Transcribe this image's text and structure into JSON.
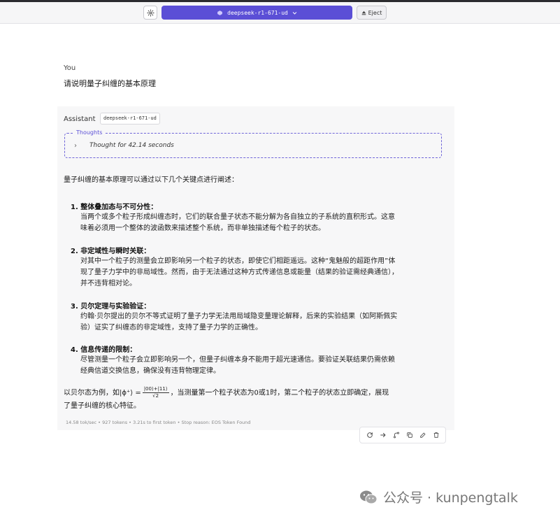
{
  "header": {
    "model_name": "deepseek-r1-671-ud",
    "eject_label": "Eject"
  },
  "user": {
    "role": "You",
    "message": "请说明量子纠缠的基本原理"
  },
  "assistant": {
    "role": "Assistant",
    "model_badge": "deepseek-r1-671-ud",
    "thoughts_label": "Thoughts",
    "thoughts_summary": "Thought for 42.14 seconds",
    "intro": "量子纠缠的基本原理可以通过以下几个关键点进行阐述：",
    "points": [
      {
        "title": "1. 整体叠加态与不可分性",
        "lines": [
          "当两个或多个粒子形成纠缠态时，它们的联合量子状态不能分解为各自独立的子系统的直积形式。这意",
          "味着必须用一个整体的波函数来描述整个系统，而非单独描述每个粒子的状态。"
        ]
      },
      {
        "title": "2. 非定域性与瞬时关联",
        "lines": [
          "对其中一个粒子的测量会立即影响另一个粒子的状态，即使它们相距遥远。这种“鬼魅般的超距作用”体",
          "现了量子力学中的非局域性。然而，由于无法通过这种方式传递信息或能量（结果的验证需经典通信），",
          "并不违背相对论。"
        ]
      },
      {
        "title": "3. 贝尔定理与实验验证",
        "lines": [
          "约翰·贝尔提出的贝尔不等式证明了量子力学无法用局域隐变量理论解释，后来的实验结果（如阿斯佩实",
          "验）证实了纠缠态的非定域性，支持了量子力学的正确性。"
        ]
      },
      {
        "title": "4. 信息传递的限制",
        "lines": [
          "尽管测量一个粒子会立即影响另一个，但量子纠缠本身不能用于超光速通信。要验证关联结果仍需依赖",
          "经典信道交换信息，确保没有违背物理定律。"
        ]
      }
    ],
    "conclusion": {
      "prefix": "以贝尔态为例，如",
      "state": "|ϕ⁺⟩ =",
      "numerator": "|00⟩+|11⟩",
      "denominator": "√2",
      "suffix": "，当测量第一个粒子状态为0或1时，第二个粒子的状态立即确定，展现",
      "line2": "了量子纠缠的核心特征。"
    },
    "stats": "14.58 tok/sec • 927 tokens • 3.21s to first token • Stop reason: EOS Token Found"
  },
  "watermark": {
    "text": "公众号 · kunpengtalk"
  },
  "colors": {
    "accent": "#5b4fd6",
    "card_bg": "#f7f7f8"
  }
}
